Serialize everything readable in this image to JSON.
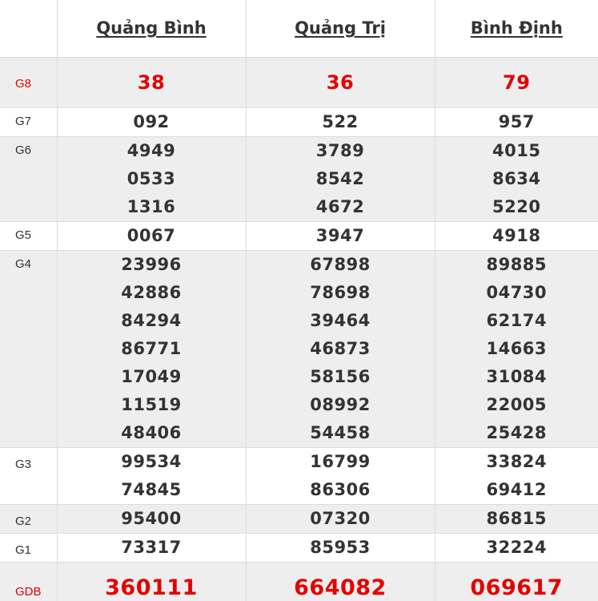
{
  "provinces": [
    "Quảng Bình",
    "Quảng Trị",
    "Bình Định"
  ],
  "colors": {
    "special": "#e40000",
    "text": "#333333",
    "stripe": "#eeeeee"
  },
  "prizes": [
    {
      "label": "G8",
      "red_label": true,
      "values": [
        [
          "38"
        ],
        [
          "36"
        ],
        [
          "79"
        ]
      ]
    },
    {
      "label": "G7",
      "red_label": false,
      "values": [
        [
          "092"
        ],
        [
          "522"
        ],
        [
          "957"
        ]
      ]
    },
    {
      "label": "G6",
      "red_label": false,
      "values": [
        [
          "4949",
          "0533",
          "1316"
        ],
        [
          "3789",
          "8542",
          "4672"
        ],
        [
          "4015",
          "8634",
          "5220"
        ]
      ]
    },
    {
      "label": "G5",
      "red_label": false,
      "values": [
        [
          "0067"
        ],
        [
          "3947"
        ],
        [
          "4918"
        ]
      ]
    },
    {
      "label": "G4",
      "red_label": false,
      "values": [
        [
          "23996",
          "42886",
          "84294",
          "86771",
          "17049",
          "11519",
          "48406"
        ],
        [
          "67898",
          "78698",
          "39464",
          "46873",
          "58156",
          "08992",
          "54458"
        ],
        [
          "89885",
          "04730",
          "62174",
          "14663",
          "31084",
          "22005",
          "25428"
        ]
      ]
    },
    {
      "label": "G3",
      "red_label": false,
      "values": [
        [
          "99534",
          "74845"
        ],
        [
          "16799",
          "86306"
        ],
        [
          "33824",
          "69412"
        ]
      ]
    },
    {
      "label": "G2",
      "red_label": false,
      "values": [
        [
          "95400"
        ],
        [
          "07320"
        ],
        [
          "86815"
        ]
      ]
    },
    {
      "label": "G1",
      "red_label": false,
      "values": [
        [
          "73317"
        ],
        [
          "85953"
        ],
        [
          "32224"
        ]
      ]
    },
    {
      "label": "GDB",
      "red_label": true,
      "values": [
        [
          "360111"
        ],
        [
          "664082"
        ],
        [
          "069617"
        ]
      ]
    }
  ]
}
